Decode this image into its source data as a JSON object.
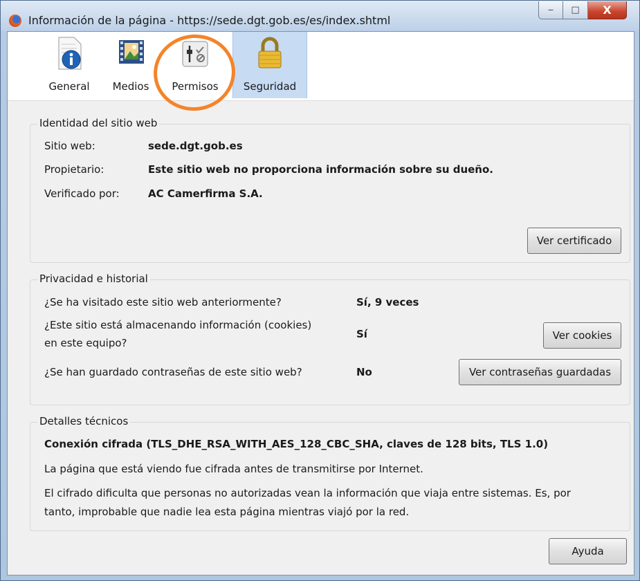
{
  "window": {
    "title": "Información de la página - https://sede.dgt.gob.es/es/index.shtml",
    "minimize": "‒",
    "maximize": "□",
    "close": "X"
  },
  "toolbar": {
    "tabs": [
      {
        "label": "General",
        "icon": "info-icon"
      },
      {
        "label": "Medios",
        "icon": "media-icon"
      },
      {
        "label": "Permisos",
        "icon": "permissions-icon"
      },
      {
        "label": "Seguridad",
        "icon": "padlock-icon",
        "selected": true
      }
    ]
  },
  "identity": {
    "title": "Identidad del sitio web",
    "rows": [
      {
        "label": "Sitio web:",
        "value": "sede.dgt.gob.es"
      },
      {
        "label": "Propietario:",
        "value": "Este sitio web no proporciona información sobre su dueño."
      },
      {
        "label": "Verificado por:",
        "value": "AC Camerfirma S.A."
      }
    ],
    "button": "Ver certificado"
  },
  "privacy": {
    "title": "Privacidad e historial",
    "rows": [
      {
        "question": "¿Se ha visitado este sitio web anteriormente?",
        "answer": "Sí, 9 veces"
      },
      {
        "question": "¿Este sitio está almacenando información (cookies)",
        "question_line2": "en este equipo?",
        "answer": "Sí"
      },
      {
        "question": "¿Se han guardado contraseñas de este sitio web?",
        "answer": "No"
      }
    ],
    "cookies_button": "Ver cookies",
    "passwords_button": "Ver contraseñas guardadas"
  },
  "technical": {
    "title": "Detalles técnicos",
    "connection": "Conexión cifrada (TLS_DHE_RSA_WITH_AES_128_CBC_SHA, claves de 128 bits, TLS 1.0)",
    "line1": "La página que está viendo fue cifrada antes de transmitirse por Internet.",
    "line2": "El cifrado dificulta que personas no autorizadas vean la información que viaja entre sistemas. Es, por",
    "line3": "tanto, improbable que nadie lea esta página mientras viajó por la red."
  },
  "footer": {
    "help_button": "Ayuda"
  },
  "colors": {
    "accent_ring": "#f4842a",
    "selected_tab": "#c7dbf3"
  }
}
